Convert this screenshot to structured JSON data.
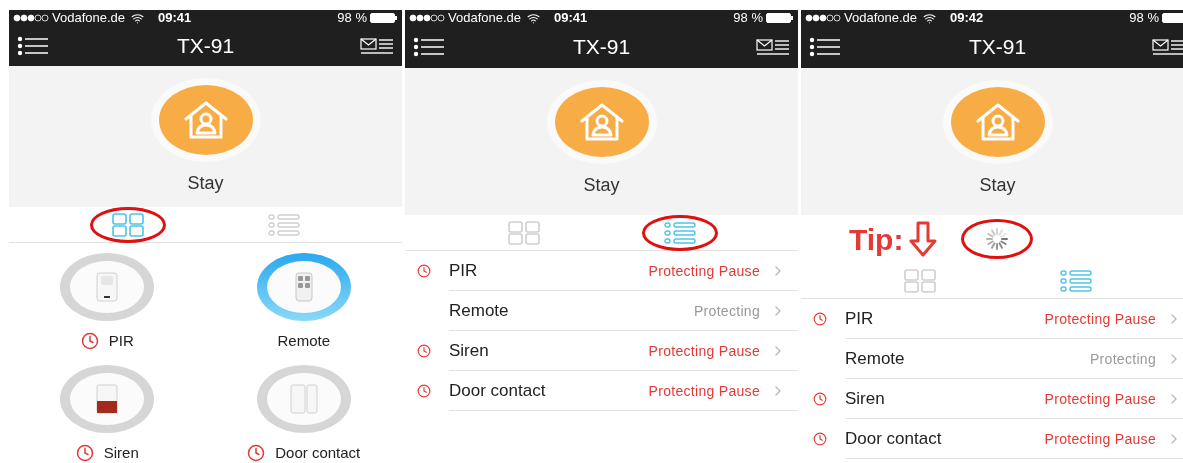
{
  "panels": [
    {
      "status_bar": {
        "carrier": "Vodafone.de",
        "time": "09:41",
        "battery": "98 %"
      },
      "title": "TX-91",
      "mode": {
        "label": "Stay"
      },
      "view_tabs": [
        {
          "kind": "grid",
          "selected": true,
          "circled": true
        },
        {
          "kind": "list",
          "selected": false,
          "circled": false
        }
      ],
      "devices": [
        {
          "name": "PIR",
          "kind": "pir",
          "paused": true
        },
        {
          "name": "Remote",
          "kind": "remote",
          "paused": false
        },
        {
          "name": "Siren",
          "kind": "siren",
          "paused": true
        },
        {
          "name": "Door contact",
          "kind": "door",
          "paused": true
        }
      ]
    },
    {
      "status_bar": {
        "carrier": "Vodafone.de",
        "time": "09:41",
        "battery": "98 %"
      },
      "title": "TX-91",
      "mode": {
        "label": "Stay"
      },
      "view_tabs": [
        {
          "kind": "grid",
          "selected": false,
          "circled": false
        },
        {
          "kind": "list",
          "selected": true,
          "circled": true
        }
      ],
      "devices": [
        {
          "name": "PIR",
          "paused": true,
          "status": "Protecting Pause"
        },
        {
          "name": "Remote",
          "paused": false,
          "status": "Protecting"
        },
        {
          "name": "Siren",
          "paused": true,
          "status": "Protecting Pause"
        },
        {
          "name": "Door contact",
          "paused": true,
          "status": "Protecting Pause"
        }
      ]
    },
    {
      "status_bar": {
        "carrier": "Vodafone.de",
        "time": "09:42",
        "battery": "98 %"
      },
      "title": "TX-91",
      "mode": {
        "label": "Stay"
      },
      "tip": {
        "label": "Tip:",
        "circled": true
      },
      "view_tabs": [
        {
          "kind": "grid",
          "selected": false,
          "circled": false
        },
        {
          "kind": "list",
          "selected": true,
          "circled": false
        }
      ],
      "devices": [
        {
          "name": "PIR",
          "paused": true,
          "status": "Protecting Pause"
        },
        {
          "name": "Remote",
          "paused": false,
          "status": "Protecting"
        },
        {
          "name": "Siren",
          "paused": true,
          "status": "Protecting Pause"
        },
        {
          "name": "Door contact",
          "paused": true,
          "status": "Protecting Pause"
        }
      ]
    }
  ]
}
